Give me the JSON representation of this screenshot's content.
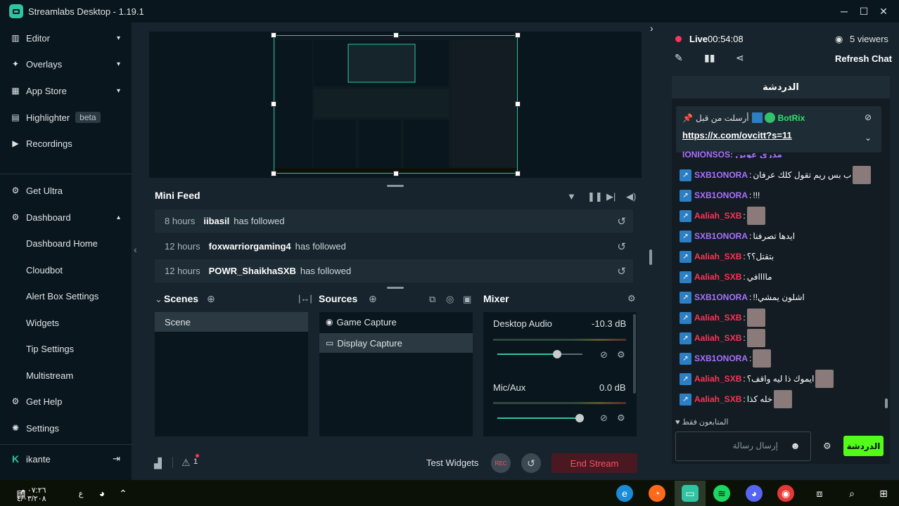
{
  "window": {
    "title": "Streamlabs Desktop - 1.19.1"
  },
  "sidebar": {
    "items": [
      {
        "label": "Editor",
        "icon": "editor-icon",
        "chevron": "▾"
      },
      {
        "label": "Overlays",
        "icon": "overlays-icon",
        "chevron": "▾"
      },
      {
        "label": "App Store",
        "icon": "app-store-icon",
        "chevron": "▾"
      },
      {
        "label": "Highlighter",
        "icon": "highlighter-icon",
        "badge": "beta"
      },
      {
        "label": "Recordings",
        "icon": "recordings-icon"
      },
      {
        "label": "Get Ultra",
        "icon": "ultra-icon"
      },
      {
        "label": "Dashboard",
        "icon": "dashboard-icon",
        "chevron": "▴"
      },
      {
        "label": "Dashboard Home"
      },
      {
        "label": "Cloudbot"
      },
      {
        "label": "Alert Box Settings"
      },
      {
        "label": "Widgets"
      },
      {
        "label": "Tip Settings"
      },
      {
        "label": "Multistream"
      },
      {
        "label": "Get Help",
        "icon": "help-icon"
      },
      {
        "label": "Settings",
        "icon": "settings-icon"
      }
    ],
    "user": {
      "name": "ikante",
      "logo": "K"
    }
  },
  "minifeed": {
    "title": "Mini Feed",
    "rows": [
      {
        "time": "8 hours",
        "user": "iibasil",
        "action": "has followed"
      },
      {
        "time": "12 hours",
        "user": "foxwarriorgaming4",
        "action": "has followed"
      },
      {
        "time": "12 hours",
        "user": "POWR_ShaikhaSXB",
        "action": "has followed"
      }
    ]
  },
  "scenes": {
    "title": "Scenes",
    "items": [
      "Scene"
    ]
  },
  "sources": {
    "title": "Sources",
    "items": [
      {
        "label": "Game Capture",
        "icon": "gamepad-icon"
      },
      {
        "label": "Display Capture",
        "icon": "monitor-icon"
      }
    ]
  },
  "mixer": {
    "title": "Mixer",
    "channels": [
      {
        "name": "Desktop Audio",
        "db": "-10.3 dB",
        "level": 0.7
      },
      {
        "name": "Mic/Aux",
        "db": "0.0 dB",
        "level": 0.97
      }
    ]
  },
  "footer": {
    "test_widgets": "Test Widgets",
    "end_stream": "End Stream",
    "alert_count": "1",
    "rec_label": "REC"
  },
  "chat": {
    "live_label": "Live",
    "live_time": "00:54:08",
    "viewers": "5 viewers",
    "refresh": "Refresh Chat",
    "tab_title": "الدردشة",
    "pinned_by": "أرسلت من قبل",
    "pinned_user": "BotRix",
    "pinned_link": "https://x.com/ovcitt?s=11",
    "cut_line": "IONIONSOS: مدري عوين",
    "messages": [
      {
        "user": "SXB1ONORA",
        "color": "#a970ff",
        "text": "ب بس ريم تقول كلك عرفان",
        "emote": true
      },
      {
        "user": "SXB1ONORA",
        "color": "#a970ff",
        "text": "!!!",
        "emote": false
      },
      {
        "user": "Aaliah_SXB",
        "color": "#ff3355",
        "text": "",
        "emote": true
      },
      {
        "user": "SXB1ONORA",
        "color": "#a970ff",
        "text": "ايدها تصرفنا",
        "emote": false
      },
      {
        "user": "Aaliah_SXB",
        "color": "#ff3355",
        "text": "بتقتل؟؟",
        "emote": false
      },
      {
        "user": "Aaliah_SXB",
        "color": "#ff3355",
        "text": "ماااافي",
        "emote": false
      },
      {
        "user": "SXB1ONORA",
        "color": "#a970ff",
        "text": "!!اشلون يمشي",
        "emote": false
      },
      {
        "user": "Aaliah_SXB",
        "color": "#ff3355",
        "text": "",
        "emote": true
      },
      {
        "user": "Aaliah_SXB",
        "color": "#ff3355",
        "text": "",
        "emote": true
      },
      {
        "user": "SXB1ONORA",
        "color": "#a970ff",
        "text": "",
        "emote": true
      },
      {
        "user": "Aaliah_SXB",
        "color": "#ff3355",
        "text": "ايموك ذا ليه واقف؟",
        "emote": true
      },
      {
        "user": "Aaliah_SXB",
        "color": "#ff3355",
        "text": "خله كذا",
        "emote": true
      }
    ],
    "followers_only": "المتابعون فقط",
    "input_placeholder": "إرسال رسالة",
    "send_label": "الدردشة"
  },
  "taskbar": {
    "clock_time": "٠٧:٢٦ م",
    "clock_date": "٤/٠٣/٢٠٨"
  }
}
